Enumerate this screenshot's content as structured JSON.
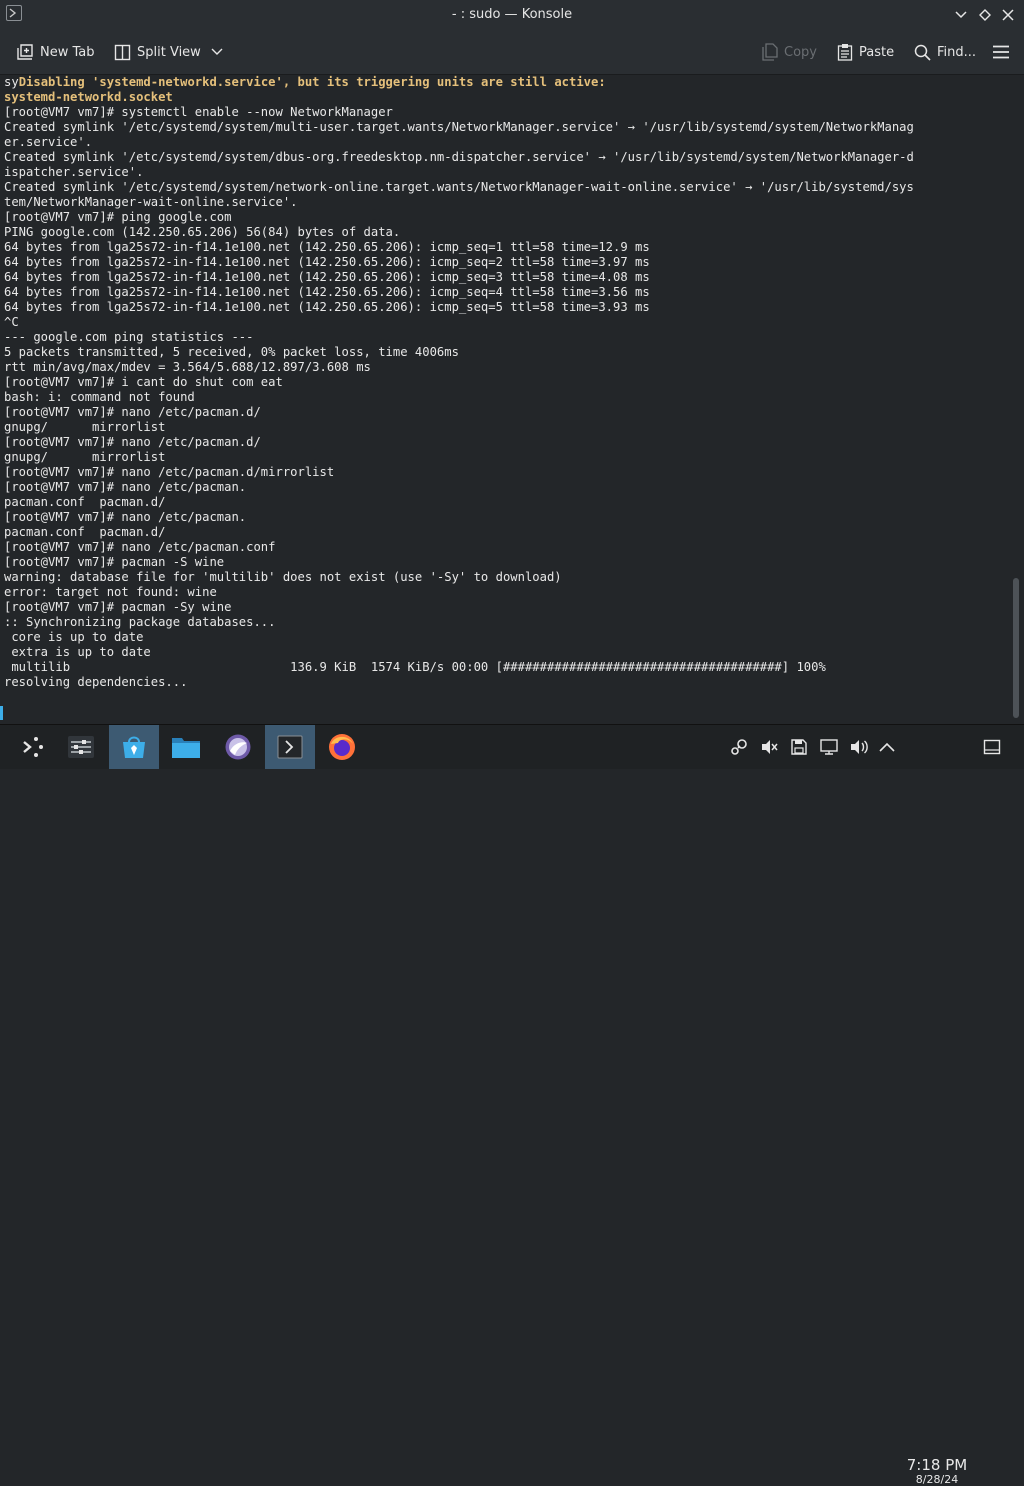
{
  "window": {
    "title": "- : sudo — Konsole"
  },
  "toolbar": {
    "new_tab": "New Tab",
    "split_view": "Split View",
    "copy": "Copy",
    "paste": "Paste",
    "find": "Find..."
  },
  "terminal": {
    "highlight_prefix": "sy",
    "highlight_line1": "Disabling 'systemd-networkd.service', but its triggering units are still active:",
    "highlight_line2": "systemd-networkd.socket",
    "body": "[root@VM7 vm7]# systemctl enable --now NetworkManager\nCreated symlink '/etc/systemd/system/multi-user.target.wants/NetworkManager.service' → '/usr/lib/systemd/system/NetworkManag\ner.service'.\nCreated symlink '/etc/systemd/system/dbus-org.freedesktop.nm-dispatcher.service' → '/usr/lib/systemd/system/NetworkManager-d\nispatcher.service'.\nCreated symlink '/etc/systemd/system/network-online.target.wants/NetworkManager-wait-online.service' → '/usr/lib/systemd/sys\ntem/NetworkManager-wait-online.service'.\n[root@VM7 vm7]# ping google.com\nPING google.com (142.250.65.206) 56(84) bytes of data.\n64 bytes from lga25s72-in-f14.1e100.net (142.250.65.206): icmp_seq=1 ttl=58 time=12.9 ms\n64 bytes from lga25s72-in-f14.1e100.net (142.250.65.206): icmp_seq=2 ttl=58 time=3.97 ms\n64 bytes from lga25s72-in-f14.1e100.net (142.250.65.206): icmp_seq=3 ttl=58 time=4.08 ms\n64 bytes from lga25s72-in-f14.1e100.net (142.250.65.206): icmp_seq=4 ttl=58 time=3.56 ms\n64 bytes from lga25s72-in-f14.1e100.net (142.250.65.206): icmp_seq=5 ttl=58 time=3.93 ms\n^C\n--- google.com ping statistics ---\n5 packets transmitted, 5 received, 0% packet loss, time 4006ms\nrtt min/avg/max/mdev = 3.564/5.688/12.897/3.608 ms\n[root@VM7 vm7]# i cant do shut com eat\nbash: i: command not found\n[root@VM7 vm7]# nano /etc/pacman.d/\ngnupg/      mirrorlist\n[root@VM7 vm7]# nano /etc/pacman.d/\ngnupg/      mirrorlist\n[root@VM7 vm7]# nano /etc/pacman.d/mirrorlist\n[root@VM7 vm7]# nano /etc/pacman.\npacman.conf  pacman.d/\n[root@VM7 vm7]# nano /etc/pacman.\npacman.conf  pacman.d/\n[root@VM7 vm7]# nano /etc/pacman.conf\n[root@VM7 vm7]# pacman -S wine\nwarning: database file for 'multilib' does not exist (use '-Sy' to download)\nerror: target not found: wine\n[root@VM7 vm7]# pacman -Sy wine\n:: Synchronizing package databases...\n core is up to date\n extra is up to date\n multilib                              136.9 KiB  1574 KiB/s 00:00 [######################################] 100%\nresolving dependencies..."
  },
  "taskbar": {
    "clock_time": "7:18 PM",
    "clock_date": "8/28/24"
  }
}
